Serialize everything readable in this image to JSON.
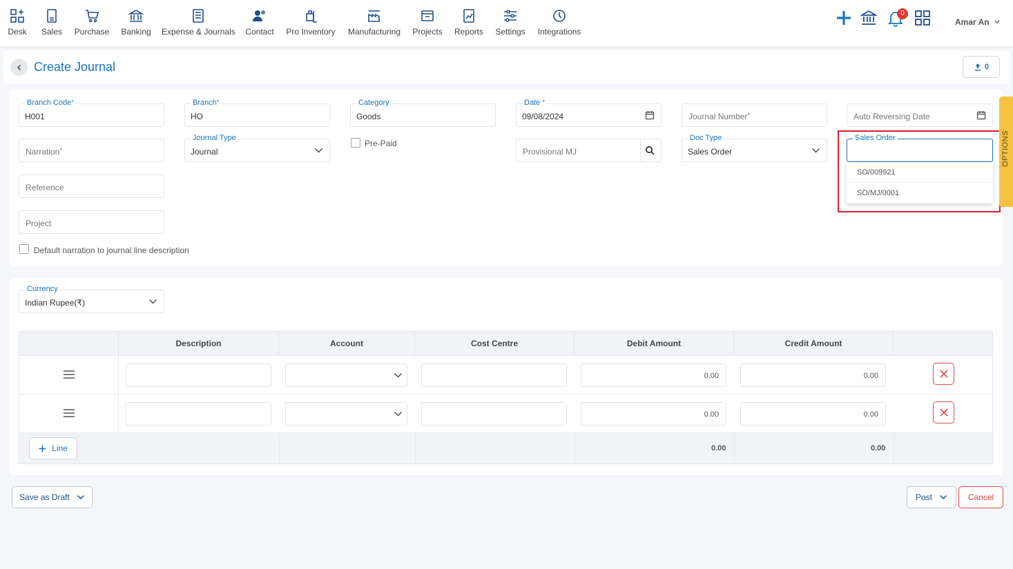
{
  "nav": {
    "items": [
      {
        "label": "Desk",
        "icon": "desk-icon"
      },
      {
        "label": "Sales",
        "icon": "sales-icon"
      },
      {
        "label": "Purchase",
        "icon": "cart-icon"
      },
      {
        "label": "Banking",
        "icon": "bank-icon"
      },
      {
        "label": "Expense & Journals",
        "icon": "journal-icon"
      },
      {
        "label": "Contact",
        "icon": "contact-icon"
      },
      {
        "label": "Pro Inventory",
        "icon": "inventory-icon"
      },
      {
        "label": "Manufacturing",
        "icon": "manufacturing-icon"
      },
      {
        "label": "Projects",
        "icon": "projects-icon"
      },
      {
        "label": "Reports",
        "icon": "reports-icon"
      },
      {
        "label": "Settings",
        "icon": "settings-icon"
      },
      {
        "label": "Integrations",
        "icon": "integrations-icon"
      }
    ],
    "notifications_count": "0",
    "user_name": "Amar An"
  },
  "header": {
    "title": "Create Journal",
    "attachment_count": "0"
  },
  "form": {
    "branch_code_label": "Branch Code",
    "branch_code_value": "H001",
    "branch_label": "Branch",
    "branch_value": "HO",
    "category_label": "Category",
    "category_value": "Goods",
    "date_label": "Date",
    "date_value": "09/08/2024",
    "journal_number_placeholder": "Journal Number",
    "auto_reversing_placeholder": "Auto Reversing Date",
    "narration_placeholder": "Narration",
    "journal_type_label": "Journal Type",
    "journal_type_value": "Journal",
    "prepaid_label": "Pre-Paid",
    "provisional_placeholder": "Provisional MJ",
    "doc_type_label": "Doc Type",
    "doc_type_value": "Sales Order",
    "sales_order_label": "Sales Order",
    "sales_order_options": [
      "SO/009921",
      "SO/MJ/0001"
    ],
    "reference_placeholder": "Reference",
    "project_placeholder": "Project",
    "default_narration_label": "Default narration to journal line description",
    "options_tab_label": "OPTIONS"
  },
  "lines": {
    "currency_label": "Currency",
    "currency_value": "Indian Rupee(₹)",
    "columns": [
      "Description",
      "Account",
      "Cost Centre",
      "Debit Amount",
      "Credit Amount"
    ],
    "rows": [
      {
        "debit": "0.00",
        "credit": "0.00"
      },
      {
        "debit": "0.00",
        "credit": "0.00"
      }
    ],
    "add_line_label": "Line",
    "total_debit": "0.00",
    "total_credit": "0.00"
  },
  "footer": {
    "save_draft_label": "Save as Draft",
    "post_label": "Post",
    "cancel_label": "Cancel"
  },
  "colors": {
    "accent": "#1b74bb",
    "danger": "#e53935",
    "options_tab": "#f5c242"
  }
}
